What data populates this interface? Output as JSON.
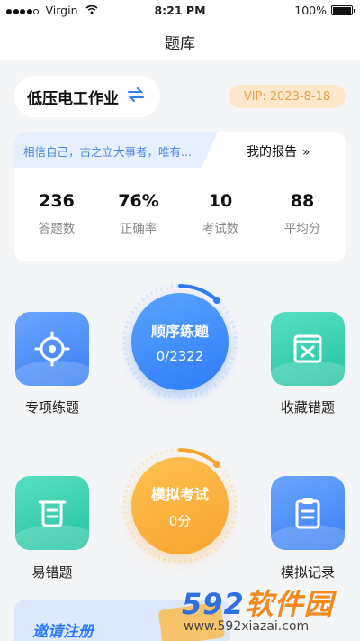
{
  "status_bar": {
    "carrier": "Virgin",
    "time": "8:21 PM",
    "battery": "100%"
  },
  "nav": {
    "title": "题库"
  },
  "subject": {
    "name": "低压电工作业",
    "switch_icon": "swap-arrows-icon"
  },
  "vip": {
    "text": "VIP: 2023-8-18"
  },
  "stats_card": {
    "motto": "相信自己，古之立大事者，唯有...",
    "report_label": "我的报告",
    "stats": [
      {
        "value": "236",
        "label": "答题数"
      },
      {
        "value": "76%",
        "label": "正确率"
      },
      {
        "value": "10",
        "label": "考试数"
      },
      {
        "value": "88",
        "label": "平均分"
      }
    ]
  },
  "tiles": {
    "special": {
      "label": "专项练题",
      "icon": "target-icon"
    },
    "favorites": {
      "label": "收藏错题",
      "icon": "bookmark-x-icon"
    },
    "error_prone": {
      "label": "易错题",
      "icon": "list-box-icon"
    },
    "exam_record": {
      "label": "模拟记录",
      "icon": "clipboard-icon"
    }
  },
  "sequential": {
    "title": "顺序练题",
    "progress": "0/2322"
  },
  "mock_exam": {
    "title": "模拟考试",
    "score": "0分"
  },
  "invite": {
    "label": "邀请注册"
  },
  "watermark": {
    "brand_a": "592",
    "brand_b": "软件园",
    "url": "www.592xiazai.com"
  },
  "colors": {
    "blue": "#2f7cf6",
    "orange": "#f7a430",
    "teal": "#2cc9a8",
    "vip_bg": "#fde8cc"
  }
}
